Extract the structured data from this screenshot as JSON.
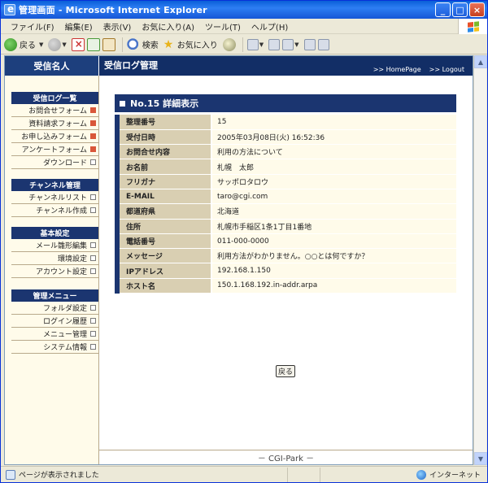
{
  "window": {
    "title": "管理画面 - Microsoft Internet Explorer",
    "buttons": [
      "_",
      "□",
      "×"
    ]
  },
  "menubar": {
    "items": [
      "ファイル(F)",
      "編集(E)",
      "表示(V)",
      "お気に入り(A)",
      "ツール(T)",
      "ヘルプ(H)"
    ]
  },
  "toolbar": {
    "back": "戻る",
    "search": "検索",
    "favorites": "お気に入り"
  },
  "header": {
    "site": "受信名人",
    "title": "受信ログ管理",
    "home_link": ">> HomePage",
    "logout_link": ">> Logout"
  },
  "sidebar": {
    "groups": [
      {
        "title": "受信ログ一覧",
        "items": [
          {
            "label": "お問合せフォーム",
            "marker": "red"
          },
          {
            "label": "資料請求フォーム",
            "marker": "red"
          },
          {
            "label": "お申し込みフォーム",
            "marker": "red"
          },
          {
            "label": "アンケートフォーム",
            "marker": "red"
          },
          {
            "label": "ダウンロード",
            "marker": "gray"
          }
        ]
      },
      {
        "title": "チャンネル管理",
        "items": [
          {
            "label": "チャンネルリスト",
            "marker": "gray"
          },
          {
            "label": "チャンネル作成",
            "marker": "gray"
          }
        ]
      },
      {
        "title": "基本設定",
        "items": [
          {
            "label": "メール雛形編集",
            "marker": "gray"
          },
          {
            "label": "環境設定",
            "marker": "gray"
          },
          {
            "label": "アカウント設定",
            "marker": "gray"
          }
        ]
      },
      {
        "title": "管理メニュー",
        "items": [
          {
            "label": "フォルダ設定",
            "marker": "gray"
          },
          {
            "label": "ログイン履歴",
            "marker": "gray"
          },
          {
            "label": "メニュー管理",
            "marker": "gray"
          },
          {
            "label": "システム情報",
            "marker": "gray"
          }
        ]
      }
    ]
  },
  "detail": {
    "heading": "No.15 詳細表示",
    "rows": [
      {
        "label": "整理番号",
        "value": "15"
      },
      {
        "label": "受付日時",
        "value": "2005年03月08日(火) 16:52:36"
      },
      {
        "label": "お問合せ内容",
        "value": "利用の方法について"
      },
      {
        "label": "お名前",
        "value": "札幌　太郎"
      },
      {
        "label": "フリガナ",
        "value": "サッポロタロウ"
      },
      {
        "label": "E-MAIL",
        "value": "taro@cgi.com"
      },
      {
        "label": "都道府県",
        "value": "北海道"
      },
      {
        "label": "住所",
        "value": "札幌市手稲区1条1丁目1番地"
      },
      {
        "label": "電話番号",
        "value": "011-000-0000"
      },
      {
        "label": "メッセージ",
        "value": "利用方法がわかりません。○○とは何ですか？"
      },
      {
        "label": "IPアドレス",
        "value": "192.168.1.150"
      },
      {
        "label": "ホスト名",
        "value": "150.1.168.192.in-addr.arpa"
      }
    ],
    "back_button": "戻る"
  },
  "footer": {
    "text": "－ CGI-Park －"
  },
  "statusbar": {
    "text": "ページが表示されました",
    "zone": "インターネット"
  },
  "colors": {
    "navy": "#1b3570",
    "header": "#122e66",
    "label_bg": "#d9cfb2",
    "value_bg": "#fffbea",
    "marker_red": "#d9573a"
  }
}
